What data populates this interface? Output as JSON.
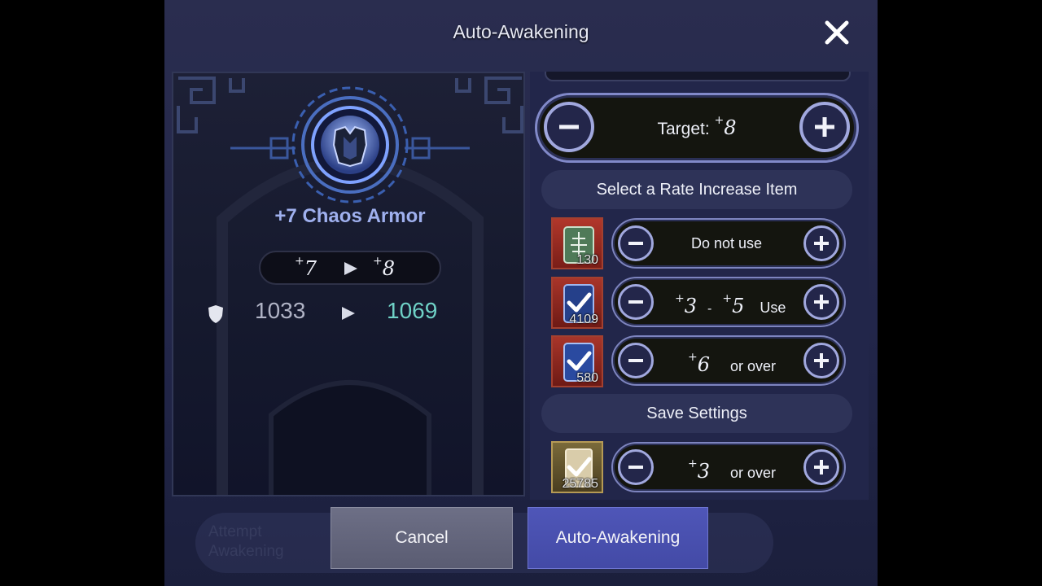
{
  "dialog": {
    "title": "Auto-Awakening"
  },
  "item": {
    "name": "+7 Chaos Armor",
    "level_from": "7",
    "level_to": "8",
    "stat_old": "1033",
    "stat_new": "1069",
    "stat_icon": "shield-icon",
    "equipment_icon": "chaos-armor-icon"
  },
  "target": {
    "label": "Target: ",
    "value": "8"
  },
  "rate_section": {
    "title": "Select a Rate Increase Item"
  },
  "rate_items": [
    {
      "count": "130",
      "icon": "green-scroll-icon",
      "checked": false,
      "text": "Do not use"
    },
    {
      "count": "4109",
      "icon": "blue-scroll-icon",
      "checked": true,
      "from": "3",
      "dash": "-",
      "to": "5",
      "suffix": "Use"
    },
    {
      "count": "580",
      "icon": "blue-scroll-icon",
      "checked": true,
      "from": "6",
      "suffix": "or over"
    }
  ],
  "save_section": {
    "title": "Save Settings"
  },
  "save_item": {
    "count": "25785",
    "count_display": "25785",
    "icon": "parchment-scroll-icon",
    "checked": true,
    "from": "3",
    "suffix": "or over"
  },
  "buttons": {
    "cancel": "Cancel",
    "confirm": "Auto-Awakening"
  },
  "background_ghost": {
    "attempt": "Attempt Awakening"
  },
  "colors": {
    "accent": "#4f56b8",
    "stat_new": "#6fd1c6",
    "item_name": "#9fb0ee",
    "pill_border": "#8189c9"
  }
}
